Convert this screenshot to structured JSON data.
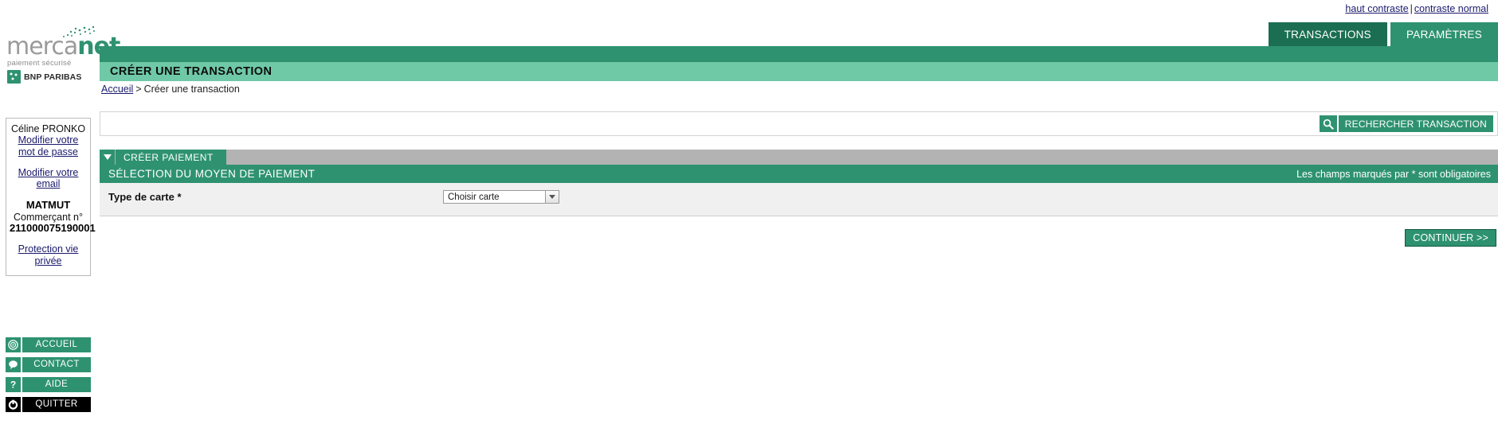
{
  "accessibility": {
    "high_contrast": "haut contraste",
    "separator": "|",
    "normal_contrast": "contraste normal"
  },
  "brand": {
    "name_part1": "merca",
    "name_part2": "net",
    "tagline": "paiement sécurisé",
    "bank": "BNP PARIBAS",
    "accent_color": "#2e9271"
  },
  "tabs": [
    {
      "label": "TRANSACTIONS",
      "active": true
    },
    {
      "label": "PARAMÈTRES",
      "active": false
    }
  ],
  "page": {
    "title": "CRÉER UNE TRANSACTION",
    "title_bar_color": "#6fc9a6"
  },
  "breadcrumb": {
    "home": "Accueil",
    "separator": ">",
    "current": "Créer une transaction"
  },
  "sidebar": {
    "user_name": "Céline PRONKO",
    "change_password": "Modifier votre mot de passe",
    "change_email": "Modifier votre email",
    "merchant_name": "MATMUT",
    "merchant_label": "Commerçant n°",
    "merchant_number": "211000075190001",
    "privacy": "Protection vie privée",
    "nav": [
      {
        "label": "ACCUEIL",
        "icon": "target-icon"
      },
      {
        "label": "CONTACT",
        "icon": "speech-bubble-icon"
      },
      {
        "label": "AIDE",
        "icon": "question-mark-icon"
      },
      {
        "label": "QUITTER",
        "icon": "power-off-icon"
      }
    ]
  },
  "search": {
    "value": "",
    "placeholder": "",
    "button_label": "RECHERCHER TRANSACTION",
    "icon": "search-icon"
  },
  "section": {
    "toggle_icon": "caret-down-icon",
    "label": "CRÉER PAIEMENT"
  },
  "panel": {
    "title": "SÉLECTION DU MOYEN DE PAIEMENT",
    "required_note": "Les champs marqués par * sont obligatoires"
  },
  "form": {
    "card_type_label": "Type de carte *",
    "card_type_value": "Choisir carte",
    "card_type_options": [
      "Choisir carte"
    ]
  },
  "actions": {
    "continue_label": "CONTINUER >>"
  }
}
